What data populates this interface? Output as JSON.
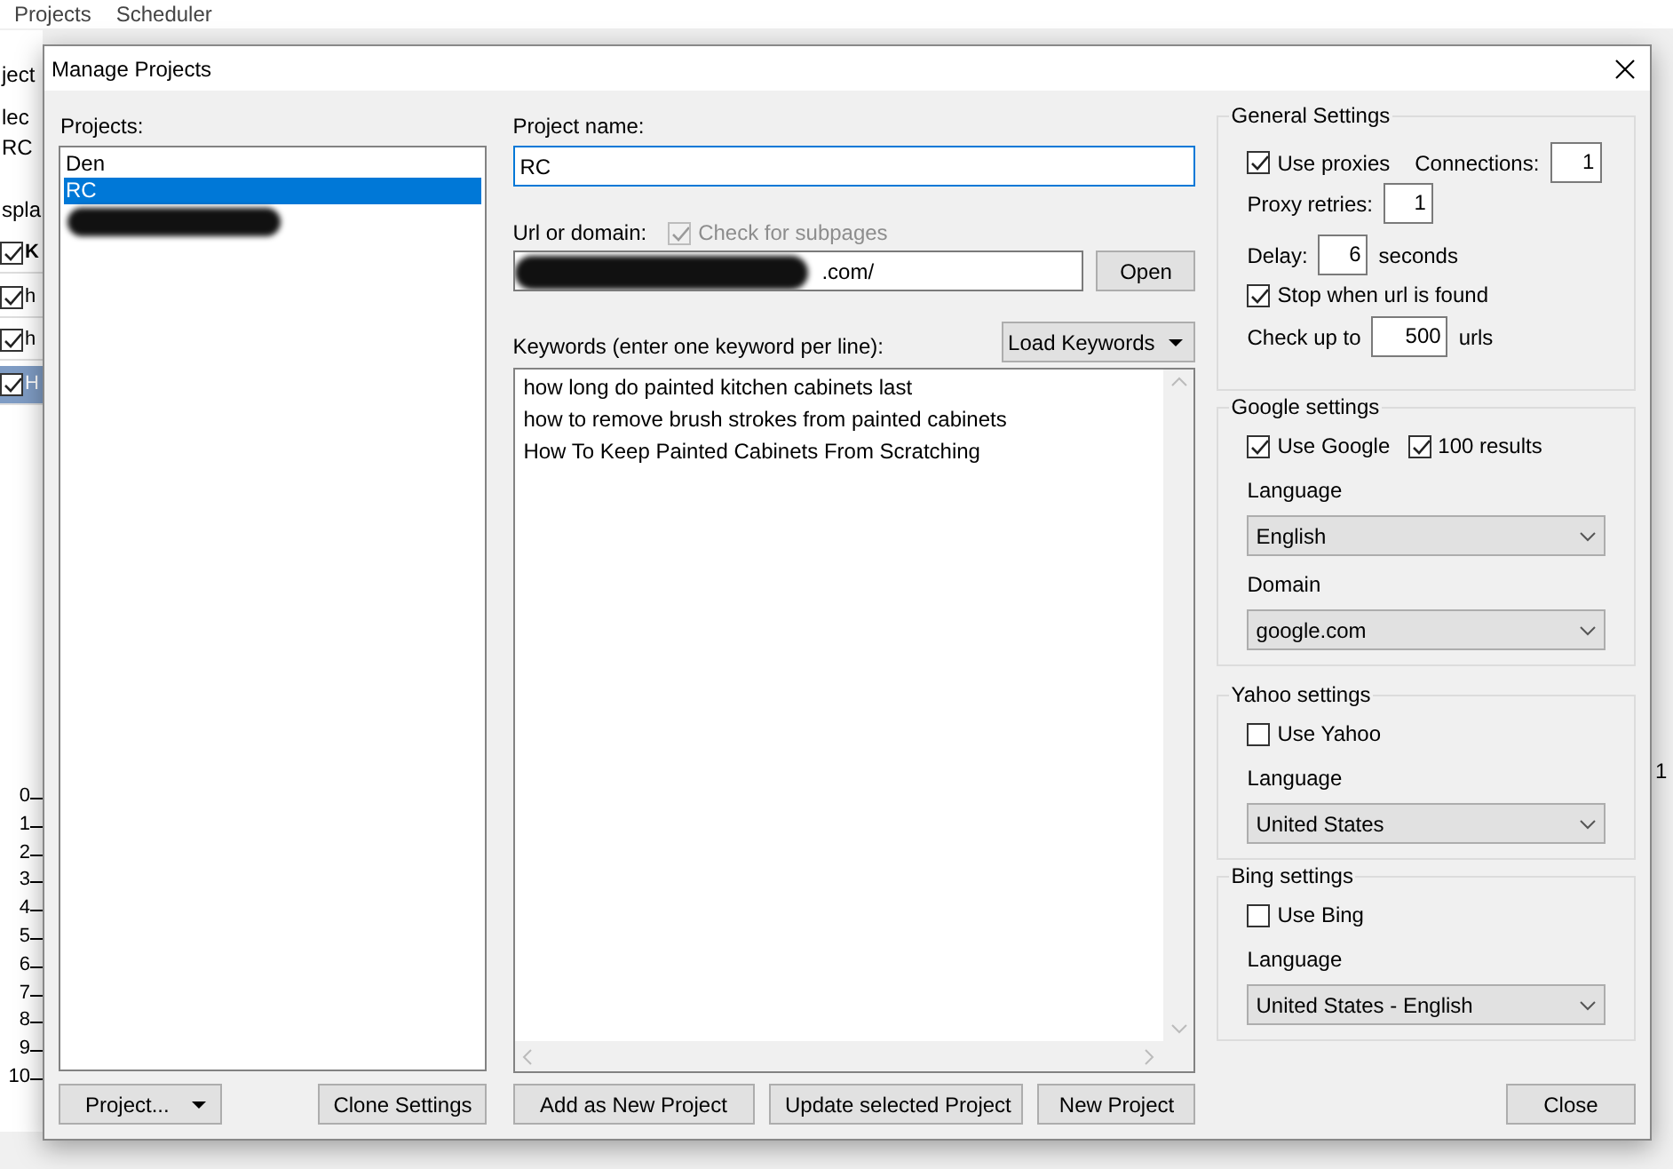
{
  "background_app": {
    "menu": [
      "Projects",
      "Scheduler"
    ],
    "side_labels": [
      "ject",
      "lec"
    ],
    "project_field": "RC",
    "display_label": "spla",
    "rows": [
      {
        "text": "K",
        "kind": "header",
        "checked": true,
        "selected": false
      },
      {
        "text": "h",
        "kind": "item",
        "checked": true,
        "selected": false
      },
      {
        "text": "h",
        "kind": "item",
        "checked": true,
        "selected": false
      },
      {
        "text": "H",
        "kind": "item",
        "checked": true,
        "selected": true
      }
    ],
    "axis_ticks": [
      "0",
      "1",
      "2",
      "3",
      "4",
      "5",
      "6",
      "7",
      "8",
      "9",
      "10"
    ],
    "right_text": "1"
  },
  "dialog": {
    "title": "Manage Projects",
    "projects_label": "Projects:",
    "projects": [
      {
        "kind": "text",
        "name": "Den",
        "selected": false
      },
      {
        "kind": "text",
        "name": "RC",
        "selected": true
      },
      {
        "kind": "redacted",
        "selected": false
      }
    ],
    "project_menu_button": "Project...",
    "clone_button": "Clone Settings",
    "project_name": {
      "label": "Project name:",
      "value": "RC"
    },
    "url": {
      "label": "Url or domain:",
      "subpages": {
        "label": "Check for subpages",
        "checked": true,
        "disabled": true
      },
      "value": ".com/",
      "redacted": true,
      "open_button": "Open"
    },
    "keywords": {
      "label": "Keywords (enter one keyword per line):",
      "load_button": "Load Keywords",
      "lines": [
        "how long do painted kitchen cabinets last",
        "how to remove brush strokes from painted cabinets",
        "How To Keep Painted Cabinets From Scratching"
      ]
    },
    "bottom_buttons": [
      "Add as New Project",
      "Update selected Project",
      "New Project"
    ],
    "general": {
      "title": "General Settings",
      "use_proxies": {
        "label": "Use proxies",
        "checked": true
      },
      "connections": {
        "label": "Connections:",
        "value": "1"
      },
      "proxy_retries": {
        "label": "Proxy retries:",
        "value": "1"
      },
      "delay": {
        "label": "Delay:",
        "value": "6",
        "unit": "seconds"
      },
      "stop_when_found": {
        "label": "Stop when url is found",
        "checked": true
      },
      "check_up_to": {
        "label": "Check up to",
        "value": "500",
        "unit": "urls"
      }
    },
    "engines": [
      {
        "title": "Google settings",
        "checkboxes": [
          {
            "label": "Use Google",
            "checked": true
          },
          {
            "label": "100 results",
            "checked": true
          }
        ],
        "selects": [
          {
            "label": "Language",
            "value": "English"
          },
          {
            "label": "Domain",
            "value": "google.com"
          }
        ]
      },
      {
        "title": "Yahoo settings",
        "checkboxes": [
          {
            "label": "Use Yahoo",
            "checked": false
          }
        ],
        "selects": [
          {
            "label": "Language",
            "value": "United States"
          }
        ]
      },
      {
        "title": "Bing settings",
        "checkboxes": [
          {
            "label": "Use Bing",
            "checked": false
          }
        ],
        "selects": [
          {
            "label": "Language",
            "value": "United States - English"
          }
        ]
      }
    ],
    "close_button": "Close"
  }
}
